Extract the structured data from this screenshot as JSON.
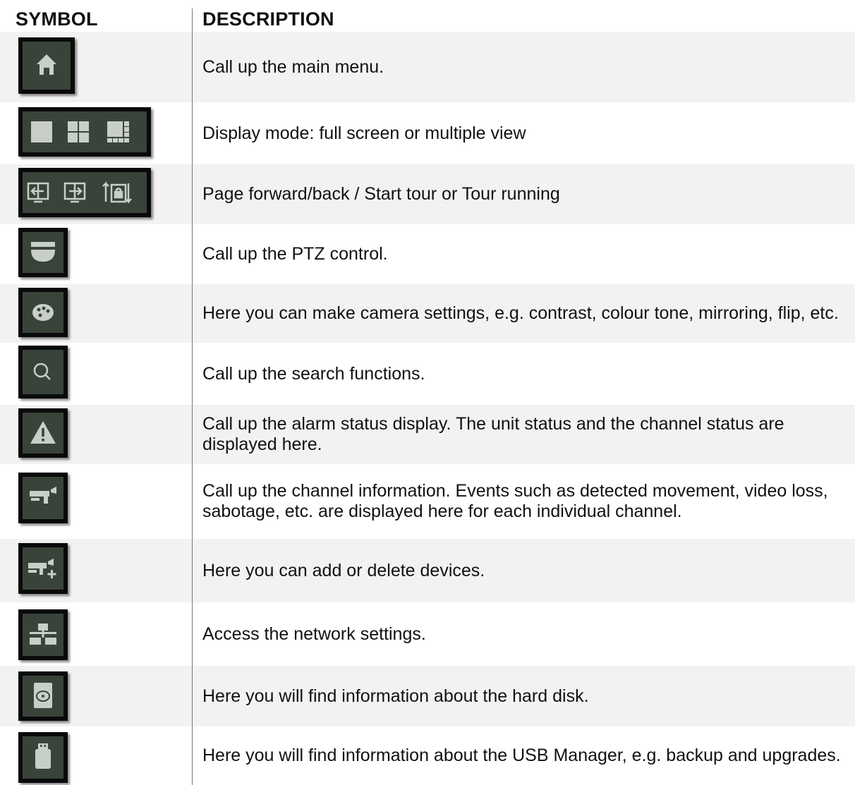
{
  "header": {
    "symbol": "SYMBOL",
    "description": "DESCRIPTION"
  },
  "rows": [
    {
      "icon": "home-icon",
      "description": "Call up the main menu."
    },
    {
      "icon": "display-mode-icons",
      "description": "Display mode: full screen or multiple view"
    },
    {
      "icon": "page-tour-icons",
      "description": "Page forward/back / Start tour or Tour running"
    },
    {
      "icon": "dome-camera-icon",
      "description": "Call up the PTZ control."
    },
    {
      "icon": "palette-icon",
      "description": "Here you can make camera settings, e.g. contrast, colour tone, mirroring, flip, etc."
    },
    {
      "icon": "search-icon",
      "description": "Call up the search functions."
    },
    {
      "icon": "warning-icon",
      "description": "Call up the alarm status display. The unit status and the channel status are displayed here."
    },
    {
      "icon": "camera-icon",
      "description": "Call up the channel information. Events such as detected movement, video loss, sabotage, etc. are displayed here for each individual channel."
    },
    {
      "icon": "add-camera-icon",
      "description": "Here you can add or delete devices."
    },
    {
      "icon": "network-icon",
      "description": "Access the network settings."
    },
    {
      "icon": "hard-disk-icon",
      "description": "Here you will find information about the hard disk."
    },
    {
      "icon": "usb-icon",
      "description": "Here you will find information about the USB Manager, e.g. backup and upgrades."
    }
  ],
  "colors": {
    "row_shade": "#f2f2f2",
    "icon_frame": "#0a0a0a",
    "icon_face": "#39433a",
    "icon_glyph": "#c8cec8"
  }
}
